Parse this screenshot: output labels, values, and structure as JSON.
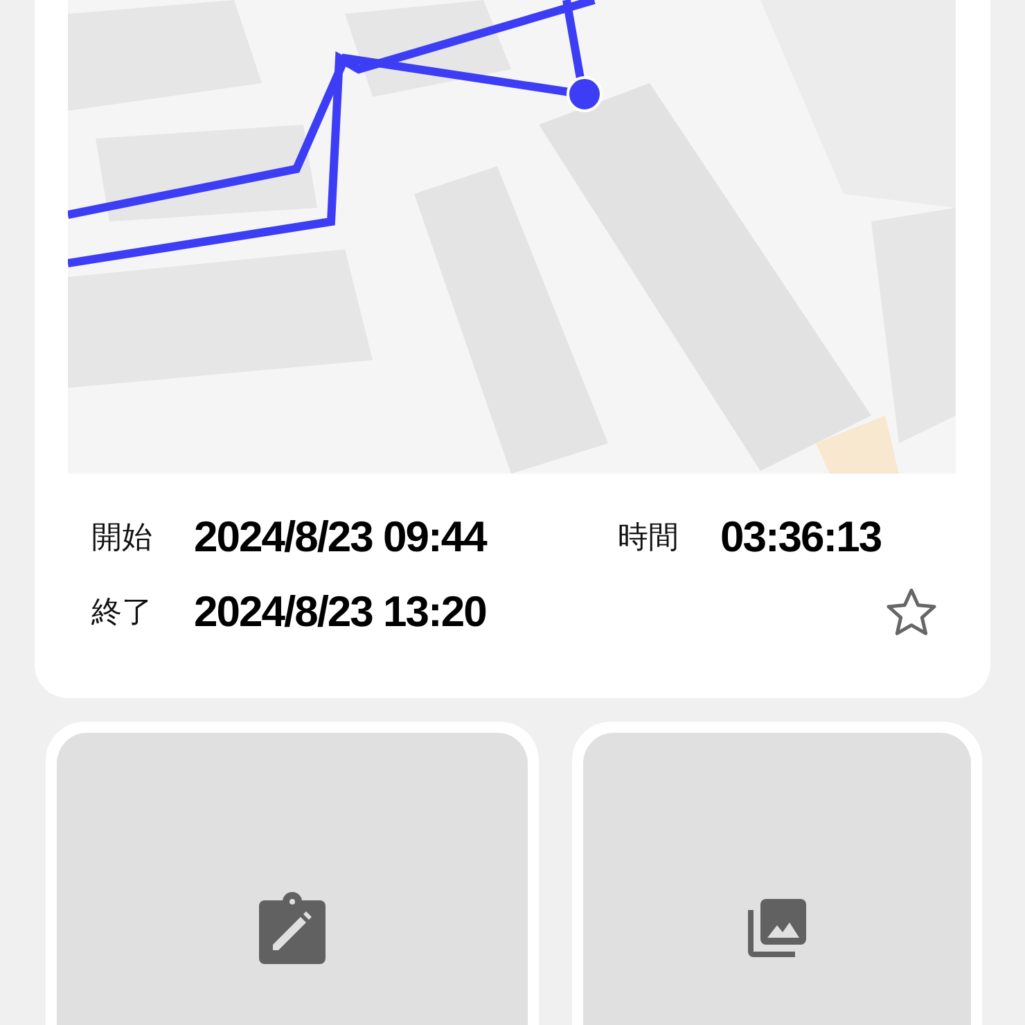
{
  "times": [
    {
      "label": "開始",
      "value": "2024/8/23 09:44"
    },
    {
      "label": "時間",
      "value": "03:36:13"
    },
    {
      "label": "終了",
      "value": "2024/8/23 13:20"
    }
  ],
  "favorite": false,
  "tiles": [
    {
      "kind": "note"
    },
    {
      "kind": "photos"
    }
  ]
}
